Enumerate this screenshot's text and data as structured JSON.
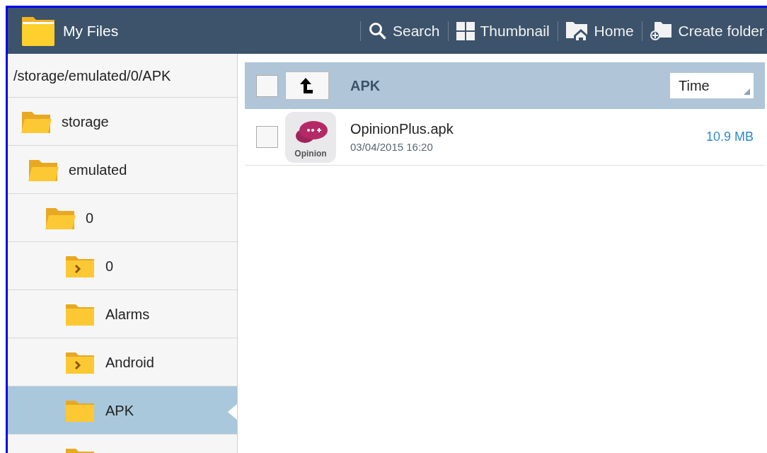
{
  "app_bar": {
    "title": "My Files",
    "actions": [
      {
        "kind": "search",
        "label": "Search"
      },
      {
        "kind": "thumbnail",
        "label": "Thumbnail"
      },
      {
        "kind": "home",
        "label": "Home"
      },
      {
        "kind": "create-folder",
        "label": "Create folder"
      }
    ]
  },
  "sidebar": {
    "path": "/storage/emulated/0/APK",
    "tree": [
      {
        "label": "storage",
        "expanded": true,
        "selected": false,
        "children": [
          {
            "label": "emulated",
            "expanded": true,
            "selected": false,
            "children": [
              {
                "label": "0",
                "expanded": true,
                "selected": false,
                "children": [
                  {
                    "label": "0",
                    "expanded": false,
                    "has_children": true,
                    "selected": false
                  },
                  {
                    "label": "Alarms",
                    "expanded": false,
                    "has_children": false,
                    "selected": false
                  },
                  {
                    "label": "Android",
                    "expanded": false,
                    "has_children": true,
                    "selected": false
                  },
                  {
                    "label": "APK",
                    "expanded": false,
                    "has_children": false,
                    "selected": true
                  },
                  {
                    "expanded": false,
                    "selected": false
                  }
                ]
              }
            ]
          }
        ]
      }
    ]
  },
  "content": {
    "folder": "APK",
    "select_all": {
      "checked": false
    },
    "sort": "Time",
    "files": [
      {
        "name": "OpinionPlus.apk",
        "date": "03/04/2015 16:20",
        "size": "10.9 MB",
        "checked": false,
        "icon_text": "Opinion"
      }
    ]
  }
}
